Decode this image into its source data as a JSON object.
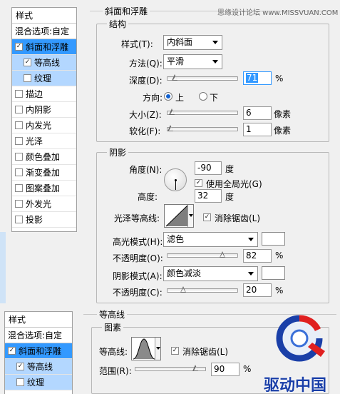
{
  "watermark_top": "思缘设计论坛 www.MISSVUAN.COM",
  "top": {
    "sidebar": {
      "title": "样式",
      "blend": "混合选项:自定",
      "items": [
        {
          "label": "斜面和浮雕",
          "checked": true
        },
        {
          "label": "等高线",
          "checked": true
        },
        {
          "label": "纹理",
          "checked": false
        },
        {
          "label": "描边",
          "checked": false
        },
        {
          "label": "内阴影",
          "checked": false
        },
        {
          "label": "内发光",
          "checked": false
        },
        {
          "label": "光泽",
          "checked": false
        },
        {
          "label": "颜色叠加",
          "checked": false
        },
        {
          "label": "渐变叠加",
          "checked": false
        },
        {
          "label": "图案叠加",
          "checked": false
        },
        {
          "label": "外发光",
          "checked": false
        },
        {
          "label": "投影",
          "checked": false
        }
      ]
    },
    "bevel": {
      "section": "斜面和浮雕",
      "structure": "结构",
      "style_label": "样式(T):",
      "style_value": "内斜面",
      "technique_label": "方法(Q):",
      "technique_value": "平滑",
      "depth_label": "深度(D):",
      "depth_value": "71",
      "depth_unit": "%",
      "direction_label": "方向:",
      "dir_up": "上",
      "dir_down": "下",
      "size_label": "大小(Z):",
      "size_value": "6",
      "size_unit": "像素",
      "soften_label": "软化(F):",
      "soften_value": "1",
      "soften_unit": "像素",
      "depth_level": 0.071,
      "size_level": 0.025,
      "soften_level": 0.0
    },
    "shading": {
      "section": "阴影",
      "angle_label": "角度(N):",
      "angle_value": "-90",
      "angle_unit": "度",
      "global_light": "使用全局光(G)",
      "altitude_label": "高度:",
      "altitude_value": "32",
      "altitude_unit": "度",
      "gloss_label": "光泽等高线:",
      "antialias": "消除锯齿(L)",
      "highlight_label": "高光模式(H):",
      "highlight_value": "滤色",
      "hl_opacity_label": "不透明度(O):",
      "hl_opacity_value": "82",
      "hl_opacity_unit": "%",
      "shadow_label": "阴影模式(A):",
      "shadow_value": "颜色减淡",
      "sh_opacity_label": "不透明度(C):",
      "sh_opacity_value": "20",
      "sh_opacity_unit": "%",
      "hl_opacity_level": 0.82,
      "sh_opacity_level": 0.2,
      "highlight_color": "#ffffff",
      "shadow_color": "#ffffff"
    }
  },
  "bottom": {
    "sidebar": {
      "title": "样式",
      "blend": "混合选项:自定",
      "items": [
        {
          "label": "斜面和浮雕",
          "checked": true
        },
        {
          "label": "等高线",
          "checked": true
        },
        {
          "label": "纹理",
          "checked": false
        }
      ]
    },
    "contour": {
      "section": "等高线",
      "elements": "图素",
      "contour_label": "等高线:",
      "antialias": "消除锯齿(L)",
      "range_label": "范围(R):",
      "range_value": "90",
      "range_unit": "%",
      "range_level": 0.9
    }
  },
  "logo_text": "驱动中国",
  "colors": {
    "selection": "#3399ff",
    "sub_selection": "#b3d7ff",
    "accent": "#1060d0",
    "logo_blue": "#1a3fa8",
    "logo_red": "#e02020"
  }
}
